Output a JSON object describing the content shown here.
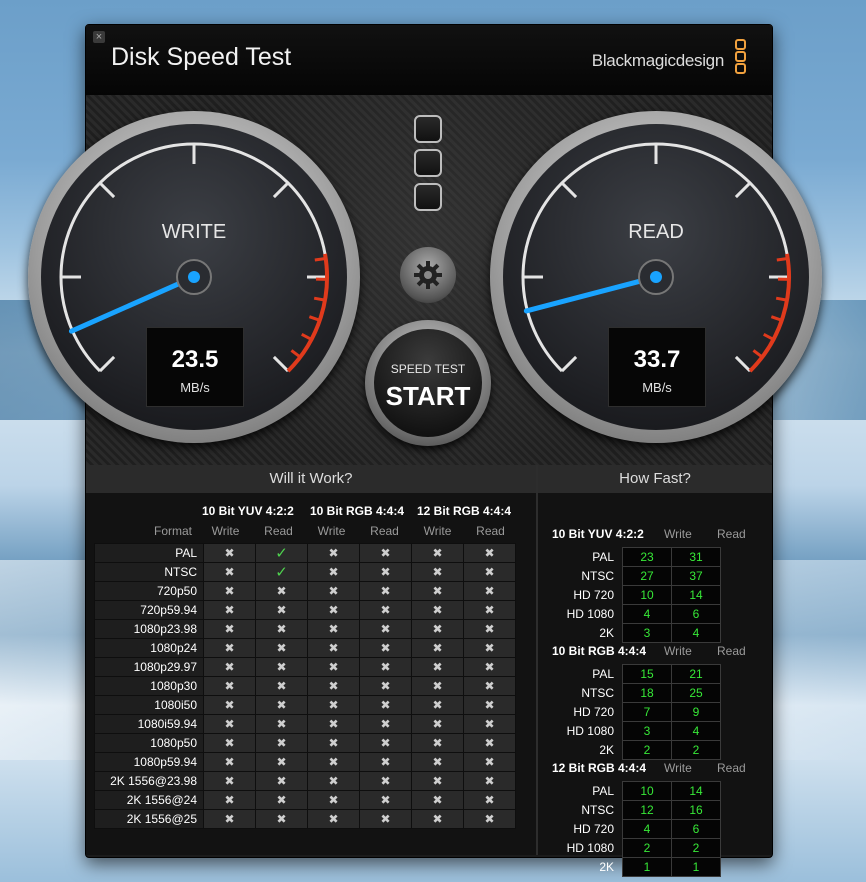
{
  "window": {
    "title": "Disk Speed Test",
    "brand": "Blackmagicdesign",
    "close_glyph": "×"
  },
  "colors": {
    "needle": "#19a3ff",
    "redline": "#e03a1c",
    "ok": "#4ed24e",
    "value": "#37e837",
    "logo": "#f1a13e"
  },
  "gauges": {
    "write": {
      "label": "WRITE",
      "value": "23.5",
      "unit": "MB/s"
    },
    "read": {
      "label": "READ",
      "value": "33.7",
      "unit": "MB/s"
    }
  },
  "controls": {
    "settings_icon": "gear-icon",
    "start_sub": "SPEED TEST",
    "start_main": "START"
  },
  "will_it_work": {
    "title": "Will it Work?",
    "format_label": "Format",
    "groups": [
      "10 Bit YUV 4:2:2",
      "10 Bit RGB 4:4:4",
      "12 Bit RGB 4:4:4"
    ],
    "sub": [
      "Write",
      "Read",
      "Write",
      "Read",
      "Write",
      "Read"
    ],
    "ok_glyph": "✓",
    "no_glyph": "✖",
    "rows": [
      {
        "format": "PAL",
        "r": [
          0,
          1,
          0,
          0,
          0,
          0
        ]
      },
      {
        "format": "NTSC",
        "r": [
          0,
          1,
          0,
          0,
          0,
          0
        ]
      },
      {
        "format": "720p50",
        "r": [
          0,
          0,
          0,
          0,
          0,
          0
        ]
      },
      {
        "format": "720p59.94",
        "r": [
          0,
          0,
          0,
          0,
          0,
          0
        ]
      },
      {
        "format": "1080p23.98",
        "r": [
          0,
          0,
          0,
          0,
          0,
          0
        ]
      },
      {
        "format": "1080p24",
        "r": [
          0,
          0,
          0,
          0,
          0,
          0
        ]
      },
      {
        "format": "1080p29.97",
        "r": [
          0,
          0,
          0,
          0,
          0,
          0
        ]
      },
      {
        "format": "1080p30",
        "r": [
          0,
          0,
          0,
          0,
          0,
          0
        ]
      },
      {
        "format": "1080i50",
        "r": [
          0,
          0,
          0,
          0,
          0,
          0
        ]
      },
      {
        "format": "1080i59.94",
        "r": [
          0,
          0,
          0,
          0,
          0,
          0
        ]
      },
      {
        "format": "1080p50",
        "r": [
          0,
          0,
          0,
          0,
          0,
          0
        ]
      },
      {
        "format": "1080p59.94",
        "r": [
          0,
          0,
          0,
          0,
          0,
          0
        ]
      },
      {
        "format": "2K 1556@23.98",
        "r": [
          0,
          0,
          0,
          0,
          0,
          0
        ]
      },
      {
        "format": "2K 1556@24",
        "r": [
          0,
          0,
          0,
          0,
          0,
          0
        ]
      },
      {
        "format": "2K 1556@25",
        "r": [
          0,
          0,
          0,
          0,
          0,
          0
        ]
      }
    ]
  },
  "how_fast": {
    "title": "How Fast?",
    "write_label": "Write",
    "read_label": "Read",
    "groups": [
      {
        "name": "10 Bit YUV 4:2:2",
        "rows": [
          {
            "format": "PAL",
            "write": "23",
            "read": "31"
          },
          {
            "format": "NTSC",
            "write": "27",
            "read": "37"
          },
          {
            "format": "HD 720",
            "write": "10",
            "read": "14"
          },
          {
            "format": "HD 1080",
            "write": "4",
            "read": "6"
          },
          {
            "format": "2K",
            "write": "3",
            "read": "4"
          }
        ]
      },
      {
        "name": "10 Bit RGB 4:4:4",
        "rows": [
          {
            "format": "PAL",
            "write": "15",
            "read": "21"
          },
          {
            "format": "NTSC",
            "write": "18",
            "read": "25"
          },
          {
            "format": "HD 720",
            "write": "7",
            "read": "9"
          },
          {
            "format": "HD 1080",
            "write": "3",
            "read": "4"
          },
          {
            "format": "2K",
            "write": "2",
            "read": "2"
          }
        ]
      },
      {
        "name": "12 Bit RGB 4:4:4",
        "rows": [
          {
            "format": "PAL",
            "write": "10",
            "read": "14"
          },
          {
            "format": "NTSC",
            "write": "12",
            "read": "16"
          },
          {
            "format": "HD 720",
            "write": "4",
            "read": "6"
          },
          {
            "format": "HD 1080",
            "write": "2",
            "read": "2"
          },
          {
            "format": "2K",
            "write": "1",
            "read": "1"
          }
        ]
      }
    ]
  }
}
